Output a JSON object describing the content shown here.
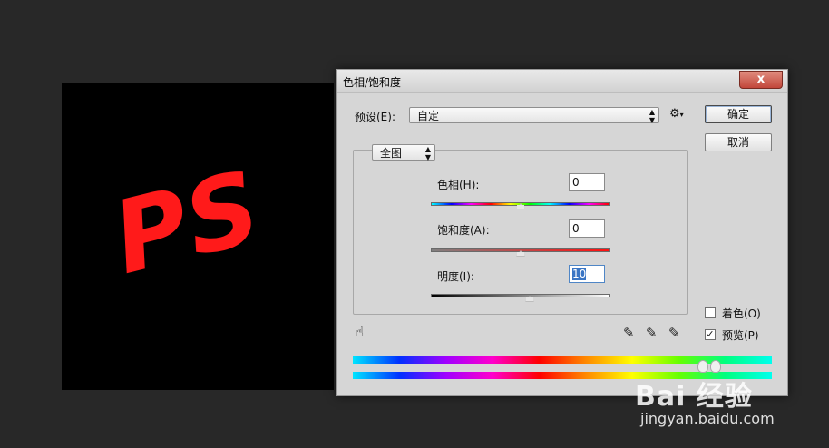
{
  "canvas": {
    "text": "PS",
    "text_color": "#ff1a1a"
  },
  "dialog": {
    "title": "色相/饱和度",
    "close_glyph": "x",
    "preset_label": "预设(E):",
    "preset_value": "自定",
    "ok_label": "确定",
    "cancel_label": "取消",
    "channel_value": "全图",
    "hue_label": "色相(H):",
    "hue_value": "0",
    "saturation_label": "饱和度(A):",
    "saturation_value": "0",
    "lightness_label": "明度(I):",
    "lightness_value": "10",
    "colorize_label": "着色(O)",
    "colorize_checked": false,
    "preview_label": "预览(P)",
    "preview_checked": true
  },
  "icons": [
    "gear-icon",
    "hand-adjust-icon",
    "eyedropper-icon",
    "eyedropper-plus-icon",
    "eyedropper-minus-icon"
  ],
  "watermark": {
    "logo": "Bai 经验",
    "url": "jingyan.baidu.com"
  }
}
